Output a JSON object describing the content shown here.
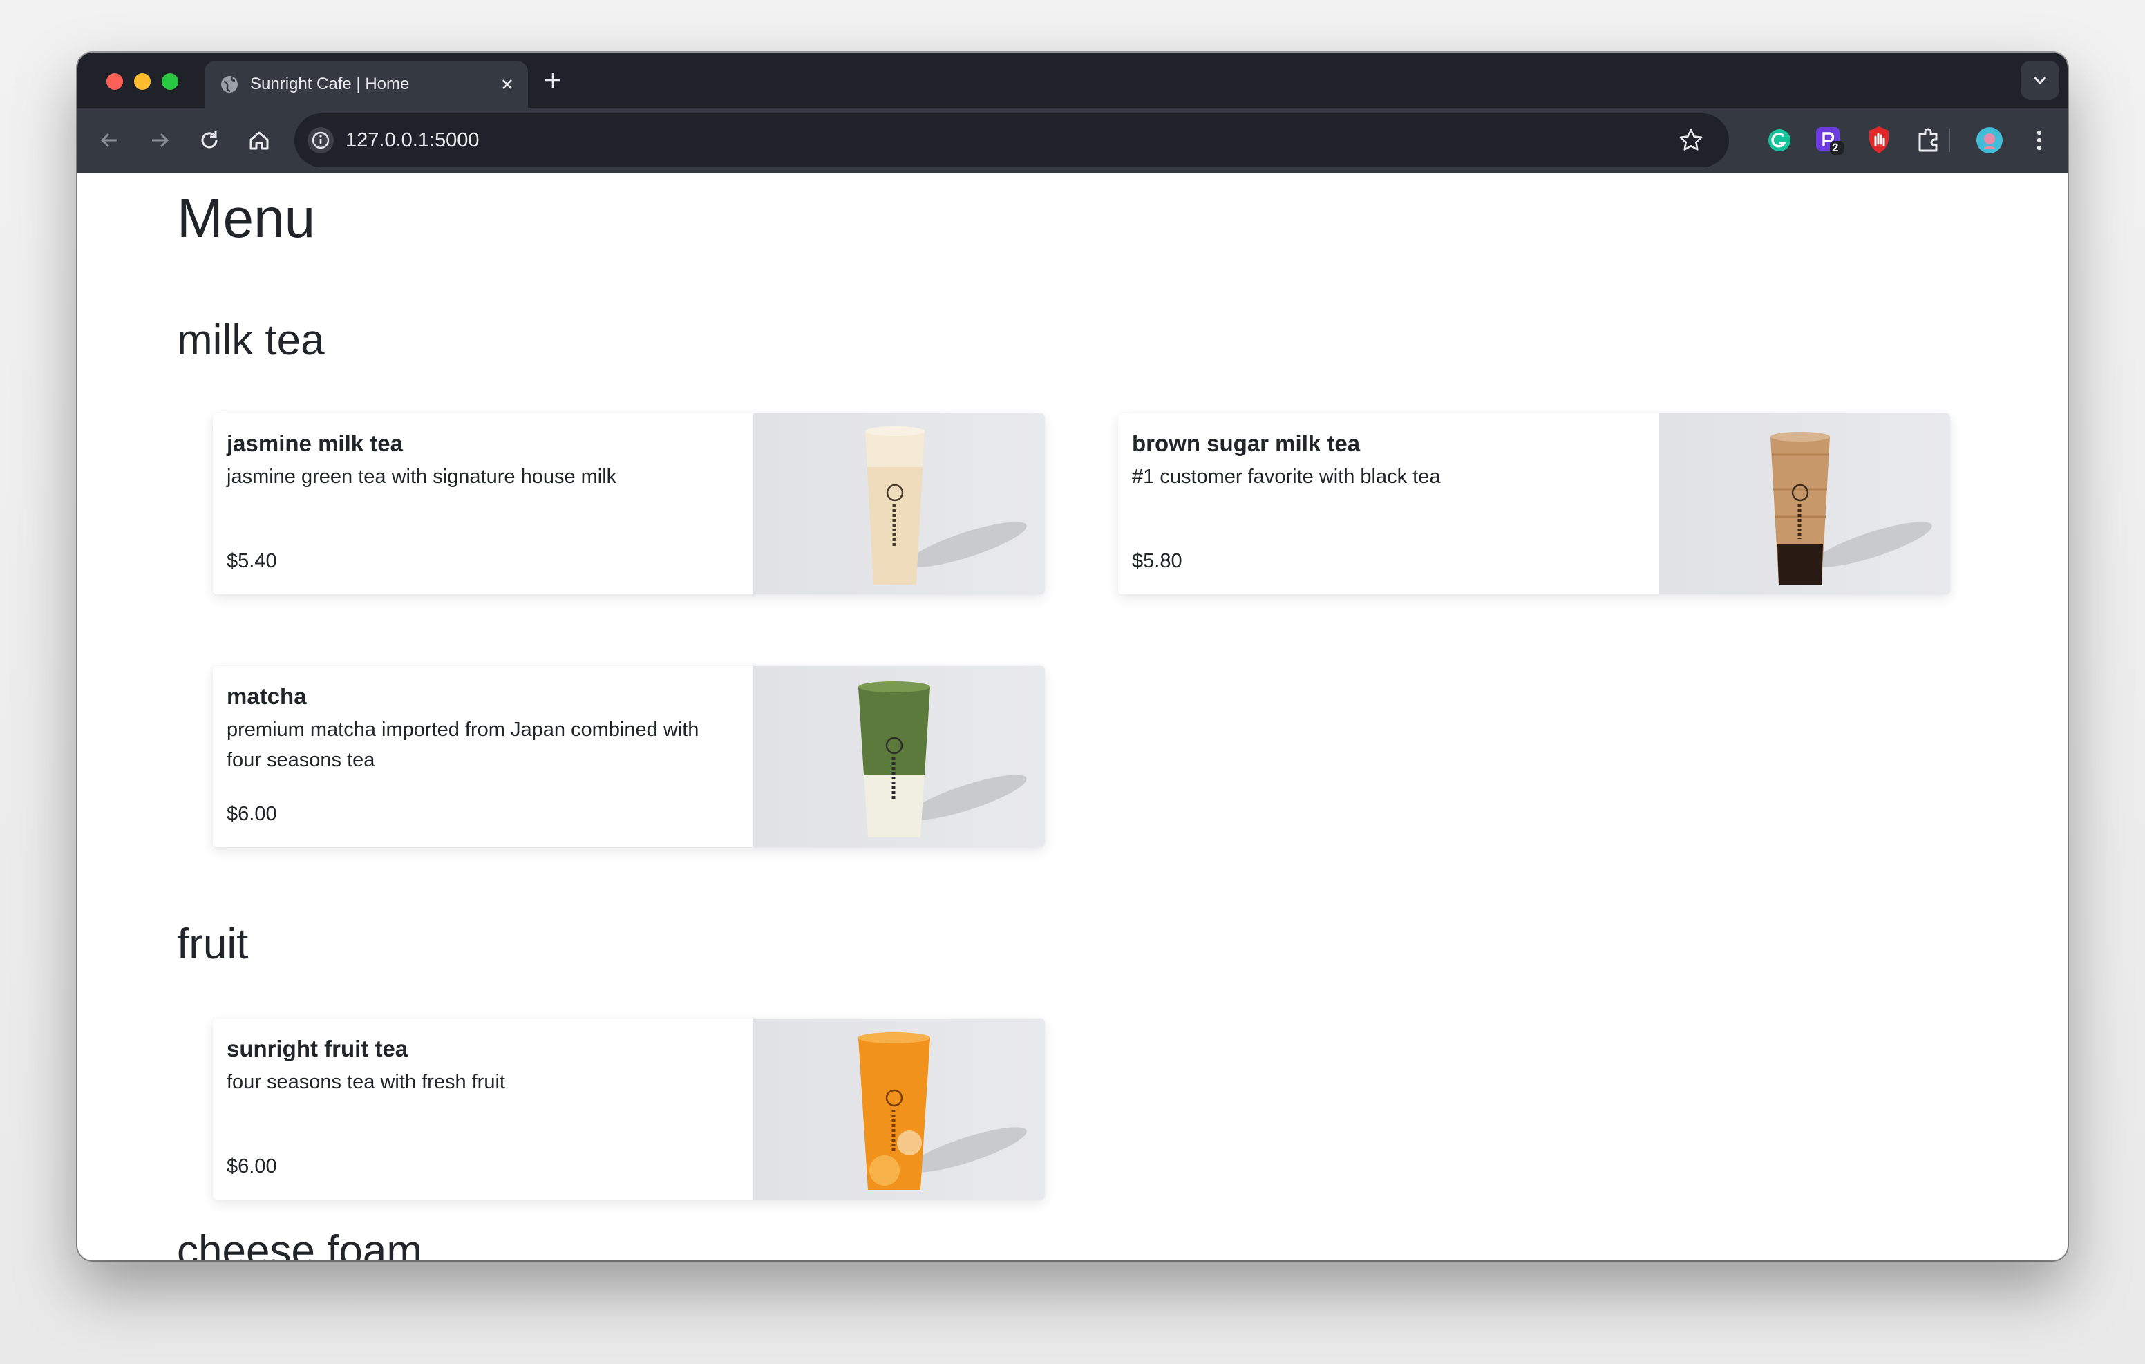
{
  "browser": {
    "tab_title": "Sunright Cafe | Home",
    "url": "127.0.0.1:5000",
    "extension_badge": "2"
  },
  "page": {
    "title": "Menu",
    "sections": [
      {
        "heading": "milk tea",
        "items": [
          {
            "name": "jasmine milk tea",
            "description": "jasmine green tea with signature house milk",
            "price": "$5.40",
            "drink_color": "#eedcbc"
          },
          {
            "name": "brown sugar milk tea",
            "description": "#1 customer favorite with black tea",
            "price": "$5.80",
            "drink_color": "#c7986a"
          },
          {
            "name": "matcha",
            "description": "premium matcha imported from Japan combined with four seasons tea",
            "price": "$6.00",
            "drink_color": "#5c7a3c"
          }
        ]
      },
      {
        "heading": "fruit",
        "items": [
          {
            "name": "sunright fruit tea",
            "description": "four seasons tea with fresh fruit",
            "price": "$6.00",
            "drink_color": "#f0921c"
          }
        ]
      },
      {
        "heading": "cheese foam",
        "items": []
      }
    ]
  }
}
